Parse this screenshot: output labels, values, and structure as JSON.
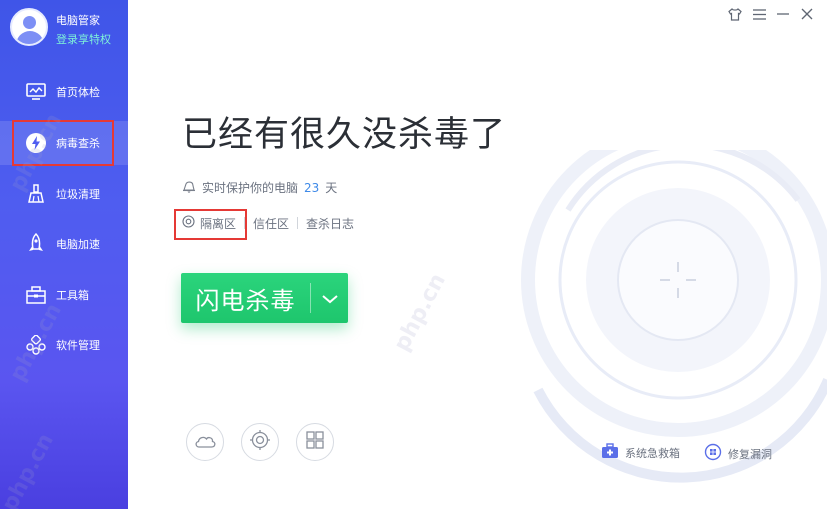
{
  "profile": {
    "name": "电脑管家",
    "login_link": "登录享特权"
  },
  "sidebar": {
    "items": [
      {
        "label": "首页体检",
        "icon": "monitor-icon"
      },
      {
        "label": "病毒查杀",
        "icon": "lightning-icon",
        "active": true
      },
      {
        "label": "垃圾清理",
        "icon": "broom-icon"
      },
      {
        "label": "电脑加速",
        "icon": "rocket-icon"
      },
      {
        "label": "工具箱",
        "icon": "toolbox-icon"
      },
      {
        "label": "软件管理",
        "icon": "app-manager-icon"
      }
    ]
  },
  "window_controls": [
    "skin-icon",
    "menu-icon",
    "minimize-icon",
    "close-icon"
  ],
  "main": {
    "headline": "已经有很久没杀毒了",
    "protect_text": "实时保护你的电脑",
    "protect_days": "23",
    "protect_unit": "天",
    "links": [
      "隔离区",
      "信任区",
      "查杀日志"
    ],
    "scan_button": "闪电杀毒",
    "round_buttons": [
      "cloud-icon",
      "target-icon",
      "windows-icon"
    ],
    "footer": {
      "rescue_box": "系统急救箱",
      "repair": "修复漏洞"
    }
  },
  "watermark": "php.cn",
  "colors": {
    "sidebar": "#4f5df0",
    "accent_green": "#1ec66d",
    "highlight_red": "#e53935",
    "days_blue": "#3f8ae8"
  }
}
